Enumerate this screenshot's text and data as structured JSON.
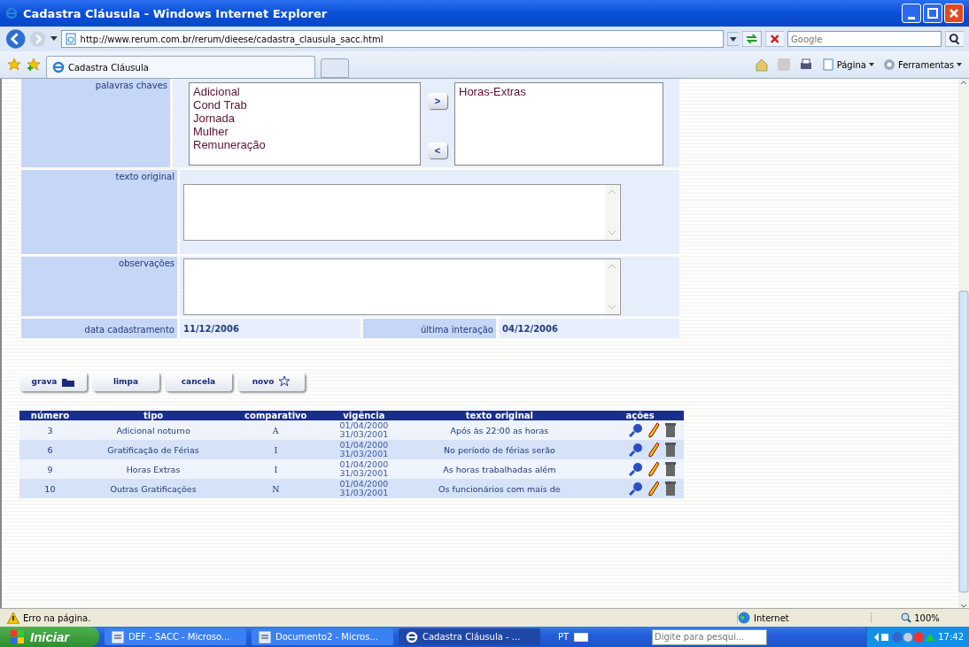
{
  "window": {
    "title": "Cadastra Cláusula - Windows Internet Explorer"
  },
  "address_bar": {
    "url": "http://www.rerum.com.br/rerum/dieese/cadastra_clausula_sacc.html"
  },
  "search": {
    "placeholder": "Google"
  },
  "tabs": [
    {
      "label": "Cadastra Cláusula",
      "selected": true
    }
  ],
  "command_bar": [
    {
      "label": "Página",
      "kind": "page"
    },
    {
      "label": "Ferramentas",
      "kind": "gear"
    }
  ],
  "form": {
    "keywords": {
      "label": "palavras chaves",
      "available": [
        "Adicional",
        "Cond Trab",
        "Jornada",
        "Mulher",
        "Remuneração"
      ],
      "chosen": [
        "Horas-Extras"
      ],
      "add": ">",
      "remove": "<"
    },
    "original_text": {
      "label": "texto original"
    },
    "notes": {
      "label": "observações"
    },
    "dates": [
      {
        "label": "data cadastramento",
        "value": "11/12/2006"
      },
      {
        "label": "última interação",
        "value": "04/12/2006"
      }
    ]
  },
  "actions": [
    {
      "label": "grava",
      "kind": "folder"
    },
    {
      "label": "limpa",
      "kind": "plain"
    },
    {
      "label": "cancela",
      "kind": "plain"
    },
    {
      "label": "novo",
      "kind": "star"
    }
  ],
  "table": {
    "columns": [
      "número",
      "tipo",
      "comparativo",
      "vigência",
      "texto original",
      "ações"
    ],
    "rows": [
      {
        "numero": "3",
        "tipo": "Adicional noturno",
        "comparativo": "A",
        "vigencia": [
          "01/04/2000",
          "31/03/2001"
        ],
        "texto": "Após às 22:00 as horas"
      },
      {
        "numero": "6",
        "tipo": "Gratificação de Férias",
        "comparativo": "I",
        "vigencia": [
          "01/04/2000",
          "31/03/2001"
        ],
        "texto": "No período de férias serão"
      },
      {
        "numero": "9",
        "tipo": "Horas Extras",
        "comparativo": "I",
        "vigencia": [
          "01/04/2000",
          "31/03/2001"
        ],
        "texto": "As horas trabalhadas além"
      },
      {
        "numero": "10",
        "tipo": "Outras Gratificações",
        "comparativo": "N",
        "vigencia": [
          "01/04/2000",
          "31/03/2001"
        ],
        "texto": "Os funcionários com mais de"
      }
    ]
  },
  "status_bar": {
    "message": "Erro na página.",
    "zone": "Internet",
    "zoom": "100%"
  },
  "taskbar": {
    "start": "Iniciar",
    "tasks": [
      {
        "label": "DEF - SACC - Microso...",
        "selected": false,
        "kind": "document"
      },
      {
        "label": "Documento2 - Micros...",
        "selected": false,
        "kind": "document"
      },
      {
        "label": "Cadastra Cláusula - ...",
        "selected": true,
        "kind": "browser"
      }
    ],
    "language": "PT",
    "search": {
      "placeholder": "Digite para pesqui..."
    },
    "clock": "17:42"
  }
}
